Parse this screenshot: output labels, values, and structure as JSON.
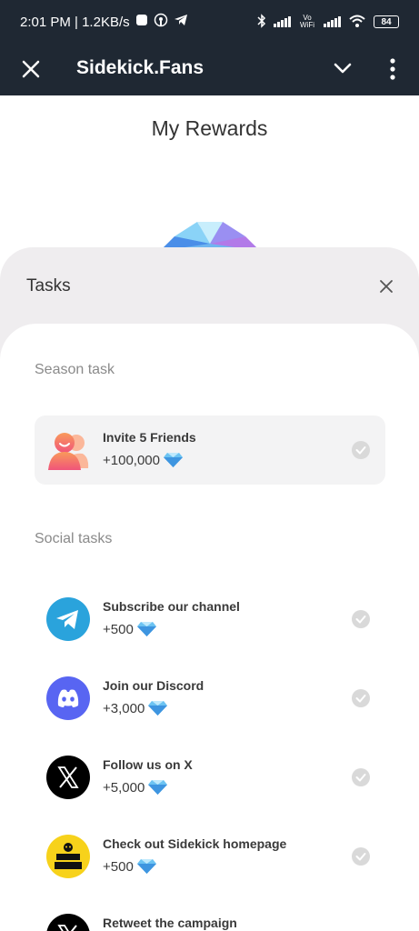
{
  "status_bar": {
    "time_speed": "2:01 PM | 1.2KB/s",
    "network_label": "Vo WiFi",
    "battery": "84"
  },
  "app_bar": {
    "title": "Sidekick.Fans",
    "close_icon": "close-icon",
    "dropdown_icon": "chevron-down-icon",
    "menu_icon": "more-vertical-icon"
  },
  "page": {
    "title": "My Rewards"
  },
  "tasks_sheet": {
    "title": "Tasks",
    "season_label": "Season task",
    "social_label": "Social tasks",
    "season_tasks": [
      {
        "title": "Invite 5 Friends",
        "reward": "+100,000",
        "icon": "friends-icon"
      }
    ],
    "social_tasks": [
      {
        "title": "Subscribe our channel",
        "reward": "+500",
        "icon": "telegram-icon"
      },
      {
        "title": "Join our Discord",
        "reward": "+3,000",
        "icon": "discord-icon"
      },
      {
        "title": "Follow us on X",
        "reward": "+5,000",
        "icon": "x-logo-icon"
      },
      {
        "title": "Check out Sidekick homepage",
        "reward": "+500",
        "icon": "sidekick-logo-icon"
      },
      {
        "title": "Retweet the campaign",
        "reward": "",
        "icon": "x-logo-icon"
      }
    ]
  },
  "colors": {
    "header_bg": "#1f2833",
    "sheet_bg": "#efedef",
    "telegram": "#2aa3dc",
    "discord": "#5865f2",
    "x": "#000000",
    "sidekick": "#f7d21b"
  }
}
